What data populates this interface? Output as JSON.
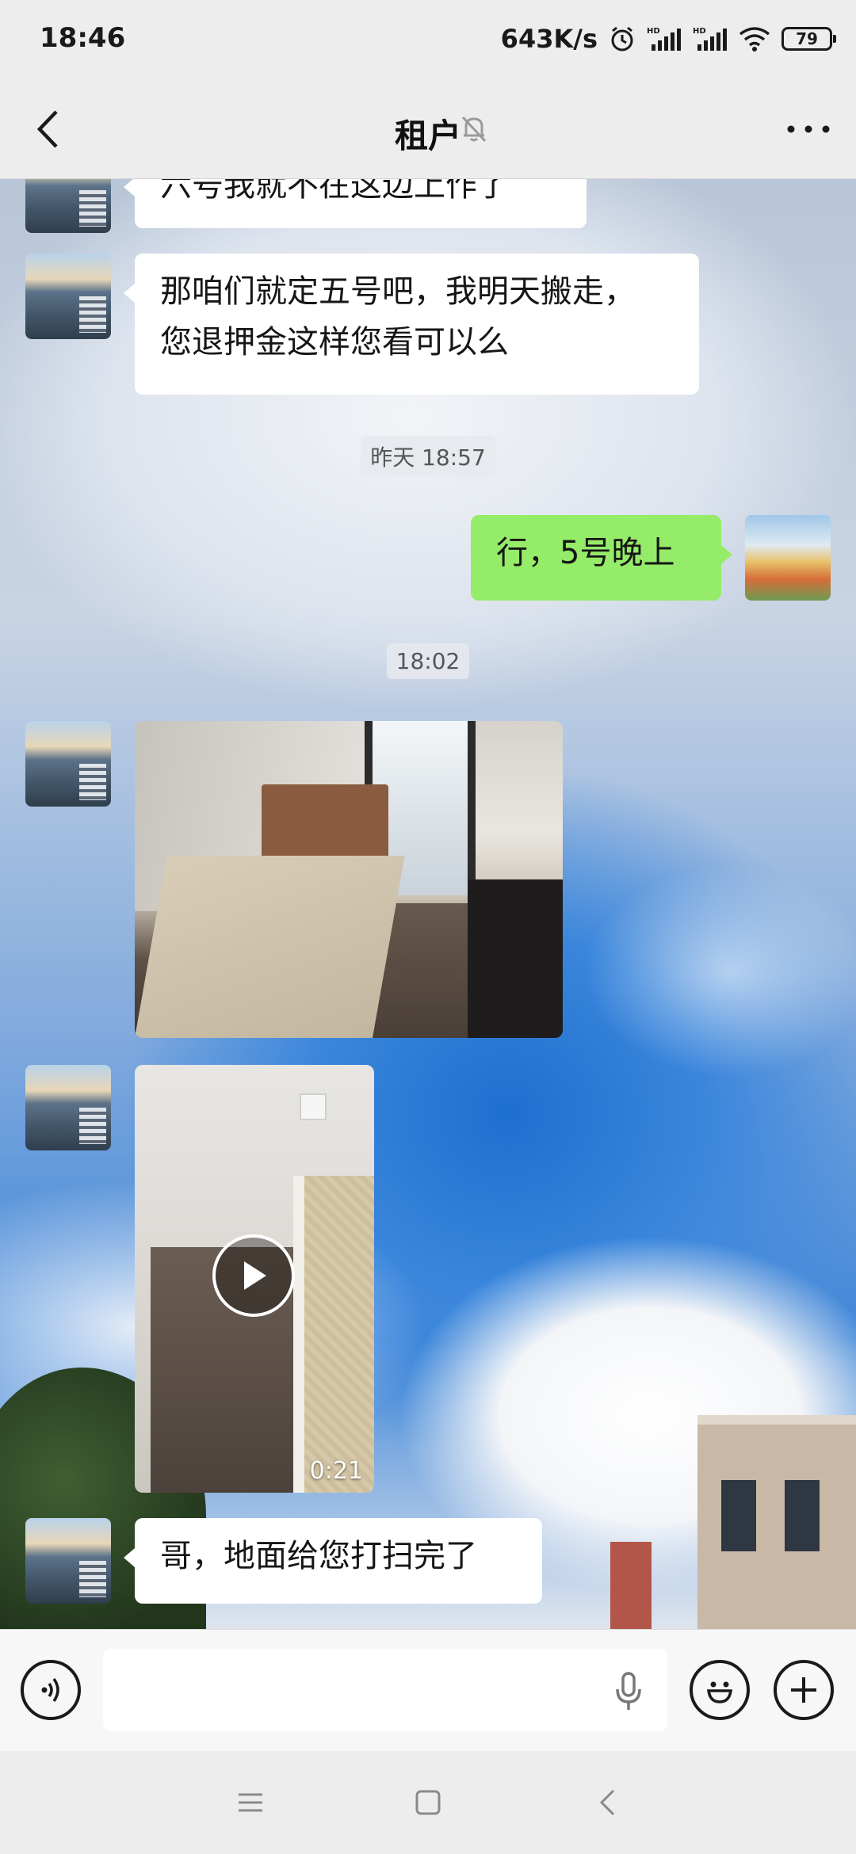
{
  "status_bar": {
    "time": "18:46",
    "net_speed": "643K/s",
    "battery": "79",
    "icons": [
      "alarm-icon",
      "signal-hd-icon",
      "signal-hd-icon",
      "wifi-icon",
      "battery-icon"
    ]
  },
  "header": {
    "title": "租户",
    "icons": [
      "back-arrow-icon",
      "mute-bell-icon",
      "more-icon"
    ]
  },
  "messages": [
    {
      "type": "text",
      "from": "other",
      "text": "六号我就不在这边上作了"
    },
    {
      "type": "text",
      "from": "other",
      "lines": [
        "那咱们就定五号吧，我明天搬走，",
        "您退押金这样您看可以么"
      ]
    },
    {
      "type": "time",
      "text": "昨天 18:57"
    },
    {
      "type": "text",
      "from": "self",
      "text": "行，5号晚上"
    },
    {
      "type": "time",
      "text": "18:02"
    },
    {
      "type": "image",
      "from": "other"
    },
    {
      "type": "video",
      "from": "other",
      "duration": "0:21"
    },
    {
      "type": "text",
      "from": "other",
      "text": "哥，地面给您打扫完了"
    }
  ],
  "input_bar": {
    "value": "",
    "icons": [
      "voice-icon",
      "microphone-icon",
      "emoji-icon",
      "plus-icon"
    ]
  },
  "nav_bar": {
    "icons": [
      "menu-icon",
      "home-square-icon",
      "back-triangle-icon"
    ]
  },
  "colors": {
    "self_bubble": "#95ec69",
    "other_bubble": "#ffffff",
    "bar_background": "#ededed"
  }
}
